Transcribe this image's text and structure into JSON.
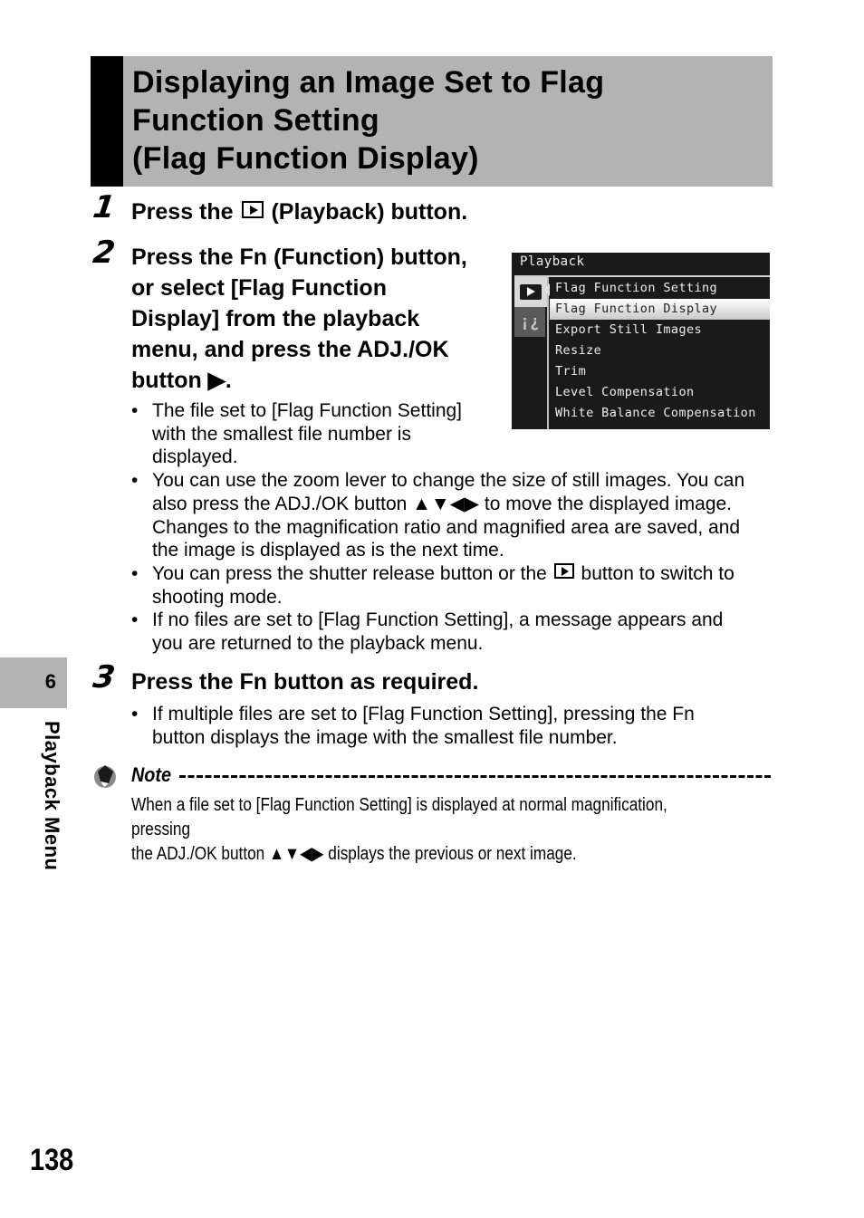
{
  "title": {
    "text": "Displaying an Image Set to Flag\nFunction Setting\n(Flag Function Display)",
    "bg_color": "#b3b3b3",
    "bar_color": "#000000"
  },
  "steps": [
    {
      "number": "1",
      "text_before_icon": "Press the",
      "icon": "playback-icon",
      "text_after_icon": "(Playback) button."
    },
    {
      "number": "2",
      "text": "Press the Fn (Function) button, or select [Flag Function Display] from the playback menu, and press the ADJ./OK button ▶.",
      "lines": [
        "Press the Fn (Function) button,",
        "or select [Flag Function",
        "Display] from the playback",
        "menu, and press the ADJ./OK",
        "button ▶."
      ],
      "bullets": [
        {
          "lines": [
            "The file set to [Flag Function Setting]",
            "with the smallest file number is",
            "displayed."
          ]
        },
        {
          "lines": [
            "You can use the zoom lever to change the size of still images. You can",
            "also press the ADJ./OK button ▲▼◀▶ to move the displayed image.",
            "Changes to the magnification ratio and magnified area are saved, and",
            "the image is displayed as is the next time."
          ]
        },
        {
          "line1_before_icon": "You can press the shutter release button or the",
          "icon": "playback-icon",
          "line1_after_icon": "button to switch to",
          "line2": "shooting mode."
        },
        {
          "lines": [
            "If no files are set to [Flag Function Setting], a message appears and",
            "you are returned to the playback menu."
          ]
        }
      ]
    },
    {
      "number": "3",
      "text": "Press the Fn button as required.",
      "bullets": [
        {
          "lines": [
            "If multiple files are set to [Flag Function Setting], pressing the Fn",
            "button displays the image with the smallest file number."
          ]
        }
      ]
    }
  ],
  "bullet_glyph": "•",
  "camera_screen": {
    "header": "Playback",
    "tabs": [
      {
        "icon": "playback-icon",
        "active": true
      },
      {
        "icon": "setup-wrench-icon",
        "active": false,
        "glyph": "¡¿"
      }
    ],
    "menu_items": [
      {
        "label": "Flag Function Setting",
        "selected": false
      },
      {
        "label": "Flag Function Display",
        "selected": true
      },
      {
        "label": "Export Still Images",
        "selected": false
      },
      {
        "label": "Resize",
        "selected": false
      },
      {
        "label": "Trim",
        "selected": false
      },
      {
        "label": "Level Compensation",
        "selected": false
      },
      {
        "label": "White Balance Compensation",
        "selected": false
      }
    ]
  },
  "note": {
    "heading": "Note",
    "lines": [
      "When a file set to [Flag Function Setting] is displayed at normal magnification, pressing",
      "the ADJ./OK button ▲▼◀▶ displays the previous or next image."
    ]
  },
  "side_tab": {
    "chapter_number": "6",
    "chapter_label": "Playback Menu"
  },
  "page_number": "138"
}
